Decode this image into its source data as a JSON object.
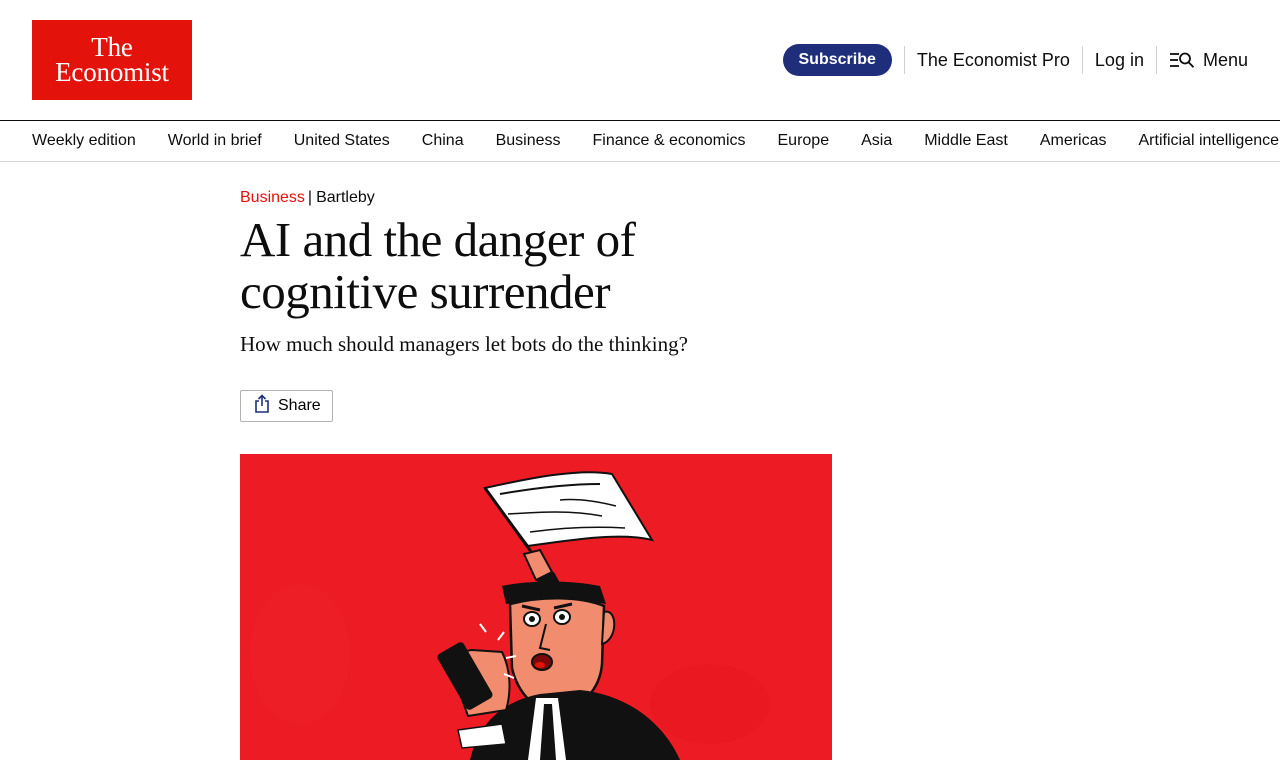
{
  "header": {
    "logo_line1": "The",
    "logo_line2": "Economist",
    "subscribe_label": "Subscribe",
    "pro_label": "The Economist Pro",
    "login_label": "Log in",
    "menu_label": "Menu"
  },
  "nav": {
    "items": [
      {
        "label": "Weekly edition"
      },
      {
        "label": "World in brief"
      },
      {
        "label": "United States"
      },
      {
        "label": "China"
      },
      {
        "label": "Business"
      },
      {
        "label": "Finance & economics"
      },
      {
        "label": "Europe"
      },
      {
        "label": "Asia"
      },
      {
        "label": "Middle East"
      },
      {
        "label": "Americas"
      },
      {
        "label": "Artificial intelligence"
      }
    ]
  },
  "article": {
    "section": "Business",
    "separator": "|",
    "column": "Bartleby",
    "headline_line1": "AI and the danger of",
    "headline_line2": "cognitive surrender",
    "standfirst": "How much should managers let bots do the thinking?",
    "share_label": "Share"
  },
  "colors": {
    "brand_red": "#e3120b",
    "subscribe_blue": "#1f2e7a",
    "illustration_red": "#ed1c24"
  },
  "icons": {
    "share": "share-icon",
    "menu": "menu-search-icon"
  }
}
